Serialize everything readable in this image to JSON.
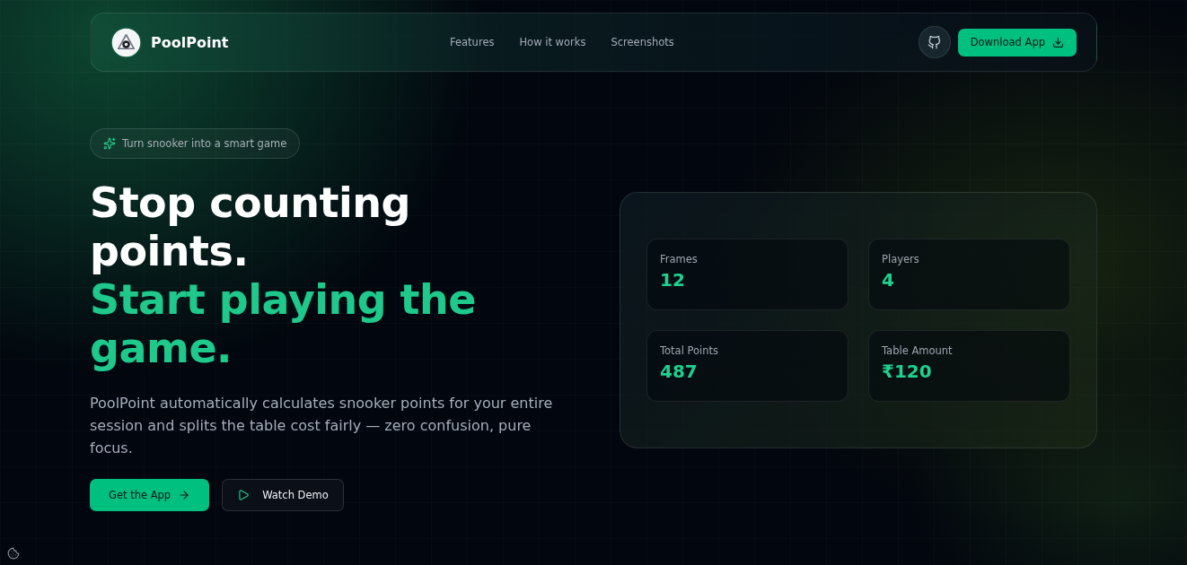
{
  "brand": {
    "name": "PoolPoint"
  },
  "nav": {
    "links": [
      {
        "label": "Features"
      },
      {
        "label": "How it works"
      },
      {
        "label": "Screenshots"
      }
    ],
    "download_button": {
      "label": "Download App"
    }
  },
  "badge": {
    "label": "Turn snooker into a smart game"
  },
  "headline": {
    "line_1": "Stop counting points.",
    "line_2": "Start playing the game."
  },
  "description": "PoolPoint automatically calculates snooker points for your entire session and splits the table cost fairly — zero confusion, pure focus.",
  "actions": [
    {
      "label": "Get the App",
      "kind": "primary"
    },
    {
      "label": "Watch Demo",
      "kind": "secondary"
    }
  ],
  "stats": [
    {
      "label": "Frames",
      "value": "12"
    },
    {
      "label": "Players",
      "value": "4"
    },
    {
      "label": "Total Points",
      "value": "487"
    },
    {
      "label": "Table Amount",
      "value": "₹120"
    }
  ]
}
